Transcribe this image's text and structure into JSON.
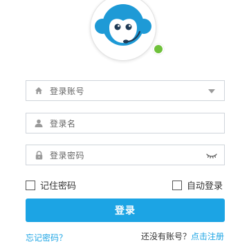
{
  "form": {
    "account_placeholder": "登录账号",
    "username_placeholder": "登录名",
    "password_placeholder": "登录密码"
  },
  "options": {
    "remember_label": "记住密码",
    "auto_login_label": "自动登录"
  },
  "actions": {
    "login_label": "登录",
    "forgot_label": "忘记密码？",
    "no_account_text": "还没有账号？",
    "register_label": "点击注册"
  },
  "colors": {
    "accent": "#1ca4e4",
    "online": "#6fc13b",
    "mascot": "#1e9ad6"
  },
  "icons": {
    "account": "home-icon",
    "username": "user-icon",
    "password": "lock-icon",
    "dropdown": "chevron-down-icon",
    "visibility": "eye-closed-icon",
    "avatar": "monkey-headset-icon"
  }
}
